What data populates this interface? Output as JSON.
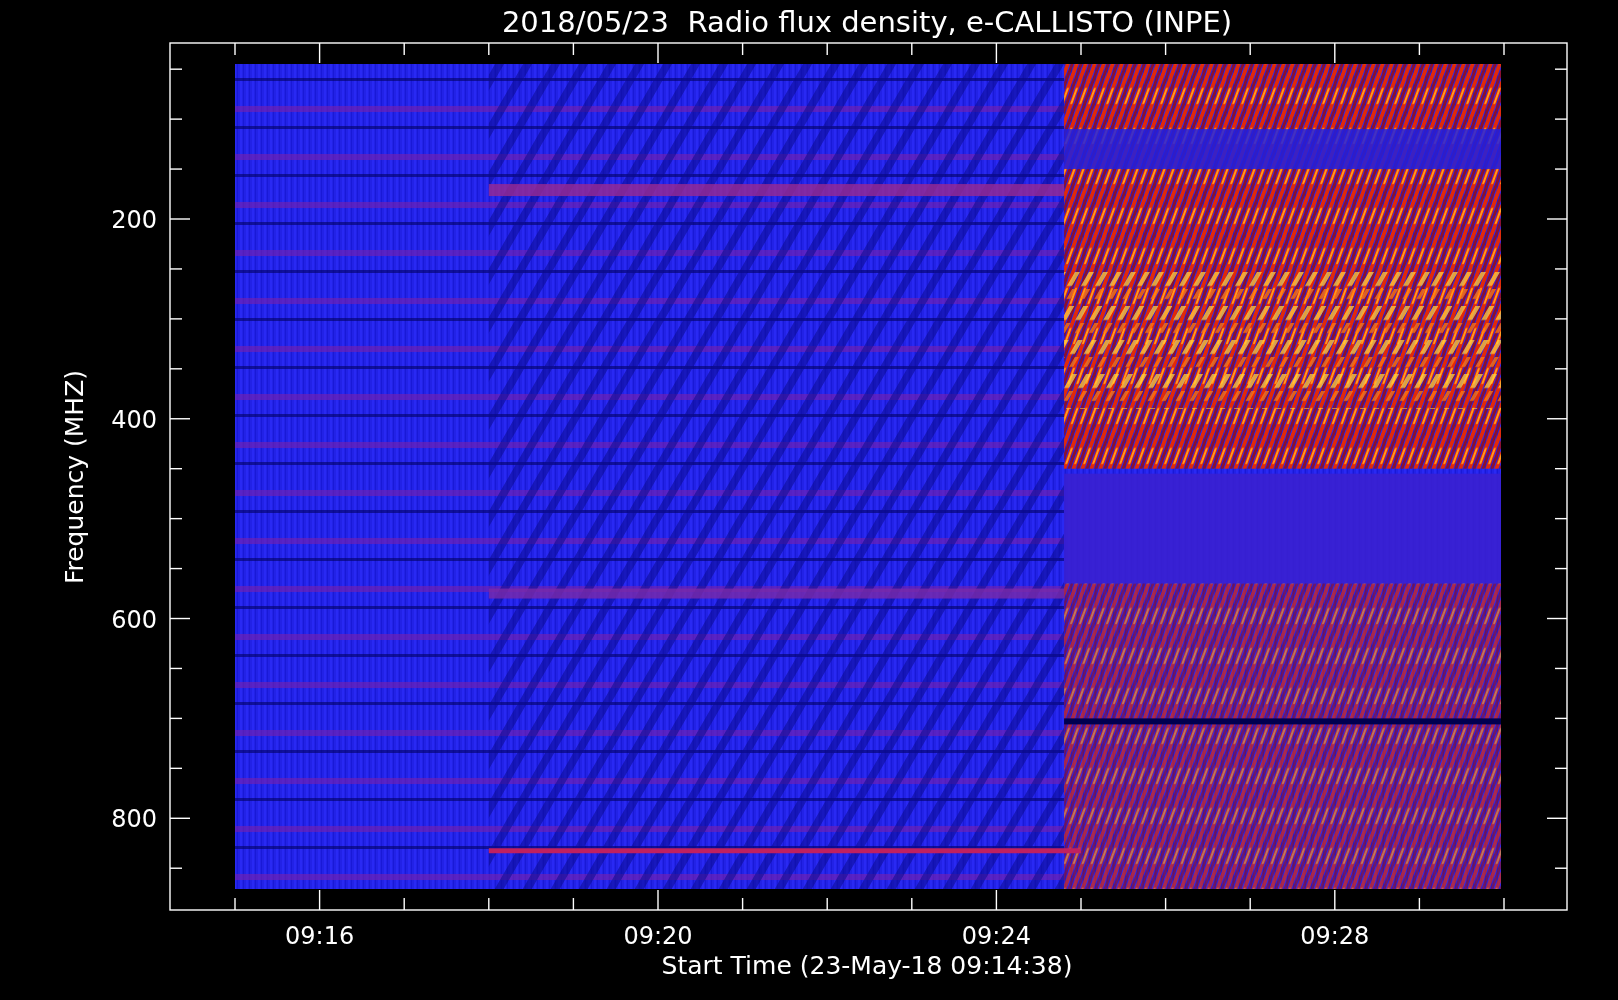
{
  "title": "2018/05/23  Radio flux density, e-CALLISTO (INPE)",
  "y_axis": {
    "label": "Frequency (MHZ)",
    "ticks": [
      "200",
      "400",
      "600",
      "800"
    ]
  },
  "x_axis": {
    "label": "Start Time (23-May-18 09:14:38)",
    "ticks": [
      "09:16",
      "09:20",
      "09:24",
      "09:28"
    ]
  }
}
